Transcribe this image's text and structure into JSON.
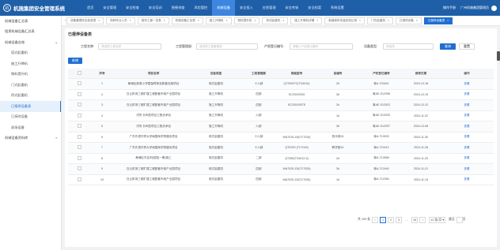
{
  "app": {
    "title": "机施集团安全管理系统",
    "logo_char": "机"
  },
  "nav": [
    "首页",
    "安全管理",
    "安全检查",
    "安全培训",
    "隐患排查",
    "风险管控",
    "机械设备",
    "安全投入",
    "应急管理",
    "安全考核",
    "安全档案",
    "系统设置"
  ],
  "nav_active": 6,
  "user": {
    "link": "操作手册",
    "name": "广州机施集团管理员"
  },
  "sidebar": [
    {
      "label": "机械设备汇总表",
      "sub": false,
      "chev": ""
    },
    {
      "label": "租赁机械设备汇总表",
      "sub": false,
      "chev": ""
    },
    {
      "label": "机械设备台账",
      "sub": false,
      "chev": "▴"
    },
    {
      "label": "塔式起重机",
      "sub": true,
      "chev": ""
    },
    {
      "label": "施工升降机",
      "sub": true,
      "chev": ""
    },
    {
      "label": "物料提升机",
      "sub": true,
      "chev": ""
    },
    {
      "label": "门式起重机",
      "sub": true,
      "chev": ""
    },
    {
      "label": "桥式起重机",
      "sub": true,
      "chev": ""
    },
    {
      "label": "已报停设备表",
      "sub": true,
      "chev": "",
      "active": true
    },
    {
      "label": "已拆除设备",
      "sub": true,
      "chev": ""
    },
    {
      "label": "退场设备",
      "sub": true,
      "chev": ""
    },
    {
      "label": "机械设备资料库",
      "sub": false,
      "chev": "▾"
    }
  ],
  "tabs": [
    {
      "label": "设备管理安全检查表",
      "active": false
    },
    {
      "label": "特种作业人员",
      "active": false
    },
    {
      "label": "塔吊工程一览表",
      "active": false
    },
    {
      "label": "机械设备汇总表",
      "active": false
    },
    {
      "label": "施工升降机",
      "active": false
    },
    {
      "label": "物料提升机",
      "active": false
    },
    {
      "label": "桥式起重机",
      "active": false
    },
    {
      "label": "施工升降机详情",
      "active": false
    },
    {
      "label": "新增塔吊安装告知记录",
      "active": false
    },
    {
      "label": "门式起重机",
      "active": false
    },
    {
      "label": "已报停设备",
      "active": false
    },
    {
      "label": "已报停设备表",
      "active": true
    }
  ],
  "panel_title": "已报停设备表",
  "filters": {
    "project_label": "工程名称:",
    "project_placeholder": "请选择工程名称",
    "manager_label": "工程管理部:",
    "manager_placeholder": "请选择工程管理部",
    "reg_label": "产权登记编号:",
    "reg_placeholder": "请输入产权登记编号",
    "type_label": "设备类型:",
    "type_placeholder": "请选择"
  },
  "buttons": {
    "query": "查询",
    "reset": "重置",
    "add": "新增"
  },
  "table": {
    "headers": [
      "",
      "序号",
      "项目名称",
      "设备类型",
      "工程管理部",
      "规格型号",
      "自编号",
      "产权登记编号",
      "报停日期",
      "操作"
    ],
    "rows": [
      [
        "1",
        "黄埔区新鲁小学暨保障房及配套设施项目",
        "塔式起重机",
        "十六部",
        "QTZ6007C(TC6010)",
        "2#",
        "粤A-T03441",
        "2024-12-18",
        "查看"
      ],
      [
        "2",
        "白云机场三期扩建工程配套市政产业园项目",
        "施工升降机",
        "四部",
        "SC200/200G",
        "3#",
        "粤AE-S12098",
        "2024-12-15",
        "查看"
      ],
      [
        "3",
        "白云机场三期扩建工程配套市政产业园项目",
        "施工升降机",
        "四部",
        "SC200/200TE",
        "2#",
        "粤AE-S12522",
        "2024-12-12",
        "查看"
      ],
      [
        "4",
        "才院 长岭居项目工程总承包",
        "施工升降机",
        "六部",
        "",
        "1#",
        "粤AE-S13025",
        "2024-11-22",
        "查看"
      ],
      [
        "5",
        "才院 长岭居项目工程总承包",
        "施工升降机",
        "六部",
        "",
        "3#",
        "粤AE-S12297",
        "2024-12-08",
        "查看"
      ],
      [
        "6",
        "广东外语外贸大学南国商学院建设项目",
        "塔式起重机",
        "十六部",
        "WA7015-10t(TC7015)",
        "西半塔2#",
        "粤A-T12633",
        "2024-11-30",
        "查看"
      ],
      [
        "7",
        "广东外语外贸大学南国商学院建设项目",
        "塔式起重机",
        "十六部",
        "QTZ200 (TC7015)",
        "教学楼1#",
        "粤A-T10012",
        "2024-11-28",
        "查看"
      ],
      [
        "8",
        "黄埔区东区科创园(一期)施工",
        "塔式起重机",
        "二部",
        "QTZ80(TC6012-6)",
        "2#",
        "粤A-T12668",
        "2024-11-25",
        "查看"
      ],
      [
        "9",
        "白云机场三期扩建工程配套市政产业园项目",
        "塔式起重机",
        "四部",
        "WA7025-12t(TC7025)",
        "3#",
        "粤A-T12440",
        "2024-11-21",
        "查看"
      ],
      [
        "10",
        "白云机场三期扩建工程配套市政产业园项目",
        "塔式起重机",
        "四部",
        "WA7025-12t(TC7025)",
        "1#",
        "粤A-T12260",
        "2024-11-15",
        "查看"
      ]
    ]
  },
  "pagination": {
    "total": "共 159 条",
    "prev": "‹",
    "pages": [
      "1",
      "2",
      "3",
      "...",
      "16"
    ],
    "active_page": "1",
    "next": "›",
    "size": "10 条/页",
    "jump_label": "跳至",
    "jump_suffix": "页"
  },
  "colors": {
    "primary": "#1f6fd1",
    "header": "#1f5fa8"
  }
}
